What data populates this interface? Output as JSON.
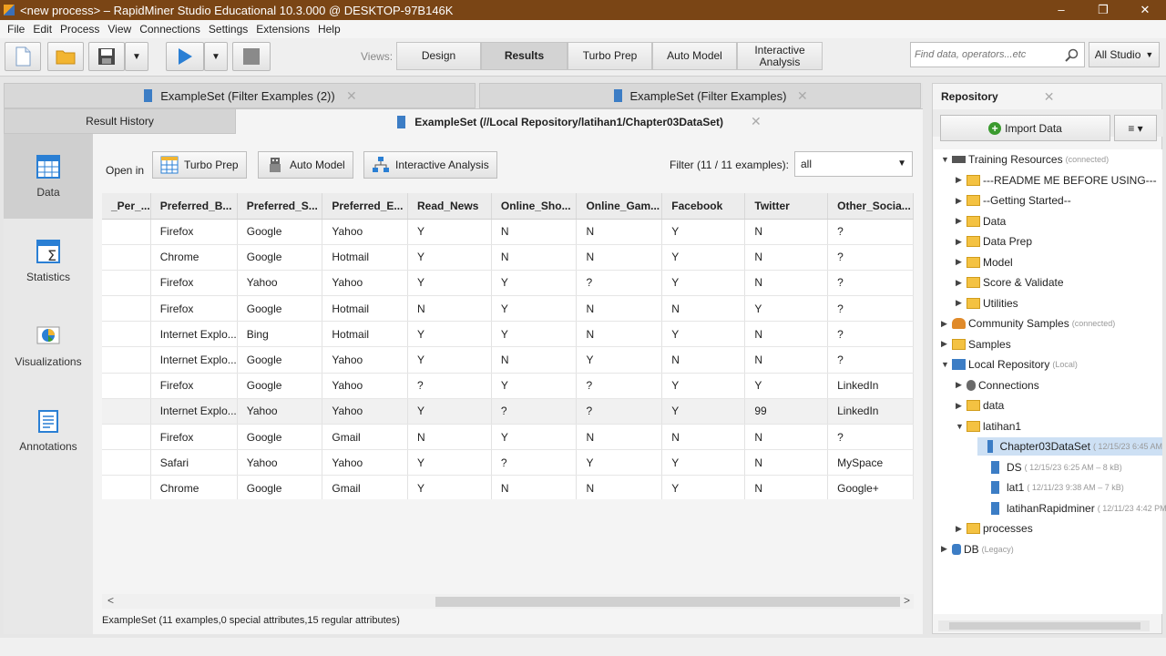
{
  "window": {
    "title": "<new process> – RapidMiner Studio Educational 10.3.000 @ DESKTOP-97B146K",
    "controls": [
      "–",
      "❐",
      "✕"
    ]
  },
  "menu": [
    "File",
    "Edit",
    "Process",
    "View",
    "Connections",
    "Settings",
    "Extensions",
    "Help"
  ],
  "toolbar": {
    "views_label": "Views:",
    "views": [
      "Design",
      "Results",
      "Turbo Prep",
      "Auto Model",
      "Interactive Analysis"
    ],
    "active_view": "Results",
    "search_placeholder": "Find data, operators...etc",
    "scope": "All Studio",
    "accent": "#2a7fd4"
  },
  "tabs": {
    "top": [
      {
        "label": "ExampleSet (Filter Examples (2))"
      },
      {
        "label": "ExampleSet (Filter Examples)"
      }
    ],
    "history": "Result History",
    "active": "ExampleSet (//Local Repository/latihan1/Chapter03DataSet)"
  },
  "sidenav": [
    "Data",
    "Statistics",
    "Visualizations",
    "Annotations"
  ],
  "results": {
    "open_in": "Open in",
    "buttons": [
      "Turbo Prep",
      "Auto Model",
      "Interactive Analysis"
    ],
    "filter_label": "Filter (11 / 11 examples):",
    "filter_value": "all",
    "columns": [
      "_Per_...",
      "Preferred_B...",
      "Preferred_S...",
      "Preferred_E...",
      "Read_News",
      "Online_Sho...",
      "Online_Gam...",
      "Facebook",
      "Twitter",
      "Other_Socia..."
    ],
    "rows": [
      [
        "",
        "Firefox",
        "Google",
        "Yahoo",
        "Y",
        "N",
        "N",
        "Y",
        "N",
        "?"
      ],
      [
        "",
        "Chrome",
        "Google",
        "Hotmail",
        "Y",
        "N",
        "N",
        "Y",
        "N",
        "?"
      ],
      [
        "",
        "Firefox",
        "Yahoo",
        "Yahoo",
        "Y",
        "Y",
        "?",
        "Y",
        "N",
        "?"
      ],
      [
        "",
        "Firefox",
        "Google",
        "Hotmail",
        "N",
        "Y",
        "N",
        "N",
        "Y",
        "?"
      ],
      [
        "",
        "Internet Explo...",
        "Bing",
        "Hotmail",
        "Y",
        "Y",
        "N",
        "Y",
        "N",
        "?"
      ],
      [
        "",
        "Internet Explo...",
        "Google",
        "Yahoo",
        "Y",
        "N",
        "Y",
        "N",
        "N",
        "?"
      ],
      [
        "",
        "Firefox",
        "Google",
        "Yahoo",
        "?",
        "Y",
        "?",
        "Y",
        "Y",
        "LinkedIn"
      ],
      [
        "",
        "Internet Explo...",
        "Yahoo",
        "Yahoo",
        "Y",
        "?",
        "?",
        "Y",
        "99",
        "LinkedIn"
      ],
      [
        "",
        "Firefox",
        "Google",
        "Gmail",
        "N",
        "Y",
        "N",
        "N",
        "N",
        "?"
      ],
      [
        "",
        "Safari",
        "Yahoo",
        "Yahoo",
        "Y",
        "?",
        "Y",
        "Y",
        "N",
        "MySpace"
      ],
      [
        "",
        "Chrome",
        "Google",
        "Gmail",
        "Y",
        "N",
        "N",
        "Y",
        "N",
        "Google+"
      ]
    ],
    "status": "ExampleSet (11 examples,0 special attributes,15 regular attributes)"
  },
  "repository": {
    "title": "Repository",
    "import": "Import Data",
    "menu": "≡ ▾",
    "nodes": [
      {
        "label": "Training Resources",
        "meta": "(connected)",
        "level": 0,
        "arrow": "▼",
        "icon": "grad-cap-icon"
      },
      {
        "label": "---README ME BEFORE USING---",
        "meta": "",
        "level": 1,
        "arrow": "▶",
        "icon": "folder-icon"
      },
      {
        "label": "--Getting Started--",
        "meta": "",
        "level": 1,
        "arrow": "▶",
        "icon": "folder-icon"
      },
      {
        "label": "Data",
        "meta": "",
        "level": 1,
        "arrow": "▶",
        "icon": "folder-icon"
      },
      {
        "label": "Data Prep",
        "meta": "",
        "level": 1,
        "arrow": "▶",
        "icon": "folder-icon"
      },
      {
        "label": "Model",
        "meta": "",
        "level": 1,
        "arrow": "▶",
        "icon": "folder-icon"
      },
      {
        "label": "Score & Validate",
        "meta": "",
        "level": 1,
        "arrow": "▶",
        "icon": "folder-icon"
      },
      {
        "label": "Utilities",
        "meta": "",
        "level": 1,
        "arrow": "▶",
        "icon": "folder-icon"
      },
      {
        "label": "Community Samples",
        "meta": "(connected)",
        "level": 0,
        "arrow": "▶",
        "icon": "people-icon"
      },
      {
        "label": "Samples",
        "meta": "",
        "level": 0,
        "arrow": "▶",
        "icon": "folder-icon"
      },
      {
        "label": "Local Repository",
        "meta": "(Local)",
        "level": 0,
        "arrow": "▼",
        "icon": "computer-icon"
      },
      {
        "label": "Connections",
        "meta": "",
        "level": 1,
        "arrow": "▶",
        "icon": "plug-icon"
      },
      {
        "label": "data",
        "meta": "",
        "level": 1,
        "arrow": "▶",
        "icon": "folder-icon"
      },
      {
        "label": "latihan1",
        "meta": "",
        "level": 1,
        "arrow": "▼",
        "icon": "folder-icon"
      },
      {
        "label": "Chapter03DataSet",
        "meta": "( 12/15/23 6:45 AM",
        "level": 2,
        "arrow": "",
        "icon": "dataset-icon",
        "selected": true
      },
      {
        "label": "DS",
        "meta": "( 12/15/23 6:25 AM – 8 kB)",
        "level": 2,
        "arrow": "",
        "icon": "dataset-icon"
      },
      {
        "label": "lat1",
        "meta": "( 12/11/23 9:38 AM – 7 kB)",
        "level": 2,
        "arrow": "",
        "icon": "dataset-icon"
      },
      {
        "label": "latihanRapidminer",
        "meta": "( 12/11/23 4:42 PM",
        "level": 2,
        "arrow": "",
        "icon": "dataset-icon"
      },
      {
        "label": "processes",
        "meta": "",
        "level": 1,
        "arrow": "▶",
        "icon": "folder-icon"
      },
      {
        "label": "DB",
        "meta": "(Legacy)",
        "level": 0,
        "arrow": "▶",
        "icon": "database-icon"
      }
    ]
  }
}
